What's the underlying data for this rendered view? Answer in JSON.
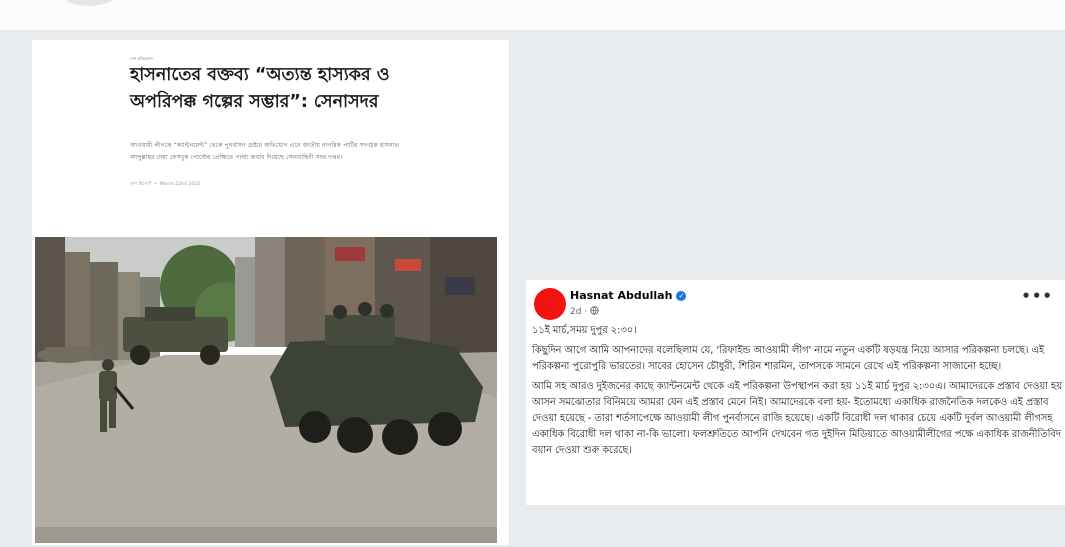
{
  "article": {
    "category": "দেশ প্রতিবেদন",
    "headline": "হাসনাতের বক্তব্য “অত্যন্ত হাস্যকর ও অপরিপক্ক গল্পের সম্ভার”: সেনাসদর",
    "lead": "আওয়ামী লীগকে “ক্যান্টনমেন্ট” থেকে পুনর্বাসন চেষ্টার অভিযোগ এনে জাতীয় নাগরিক পার্টির সংগঠক হাসনাত আব্দুল্লাহর দেয়া ফেসবুক পোস্টের প্রেক্ষিতে পাল্টা জবাব দিয়েছে সেনাবাহিনী সদর দপ্তর।",
    "byline_author": "দেশ রিপোর্ট",
    "byline_date": "March 22nd 2025"
  },
  "post": {
    "author": "Hasnat Abdullah",
    "verified_glyph": "✓",
    "time": "2d",
    "privacy_icon": "globe-icon",
    "more_glyph": "•••",
    "avatar_color": "#f2140e",
    "paragraphs": [
      "১১ই মার্চ,সময় দুপুর ২:৩০।",
      "কিছুদিন আগে আমি আপনাদের বলেছিলাম যে, 'রিফাইন্ড আওয়ামী লীগ' নামে নতুন একটি ষড়যন্ত্র নিয়ে আসার পরিকল্পনা চলছে। এই পরিকল্পনা পুরোপুরি ভারতের। সাবের হোসেন চৌধুরী, শিরিন শারমিন, তাপসকে সামনে রেখে এই পরিকল্পনা সাজানো হচ্ছে।",
      "আমি সহ আরও দুইজনের কাছে ক্যান্টনমেন্ট থেকে এই পরিকল্পনা উপস্থাপন করা হয় ১১ই মার্চ দুপুর ২:৩০এ। আমাদেরকে প্রস্তাব দেওয়া হয় আসন সমঝোতার বিনিময়ে আমরা যেন এই প্রস্তাব মেনে নিই। আমাদেরকে বলা হয়- ইতোমধ্যে একাধিক রাজনৈতিক দলকেও এই প্রস্তাব দেওয়া হয়েছে - তারা শর্তসাপেক্ষে আওয়ামী লীগ পুনর্বাসনে রাজি হয়েছে। একটি বিরোধী দল থাকার চেয়ে একটি দুর্বল আওয়ামী লীগসহ একাধিক বিরোধী দল থাকা না-কি ভালো। ফলশ্রুতিতে আপনি দেখবেন গত দুইদিন মিডিয়াতে আওয়ামীলীগের পক্ষে একাধিক রাজনীতিবিদ বয়ান দেওয়া শুরু করেছে।"
    ]
  }
}
